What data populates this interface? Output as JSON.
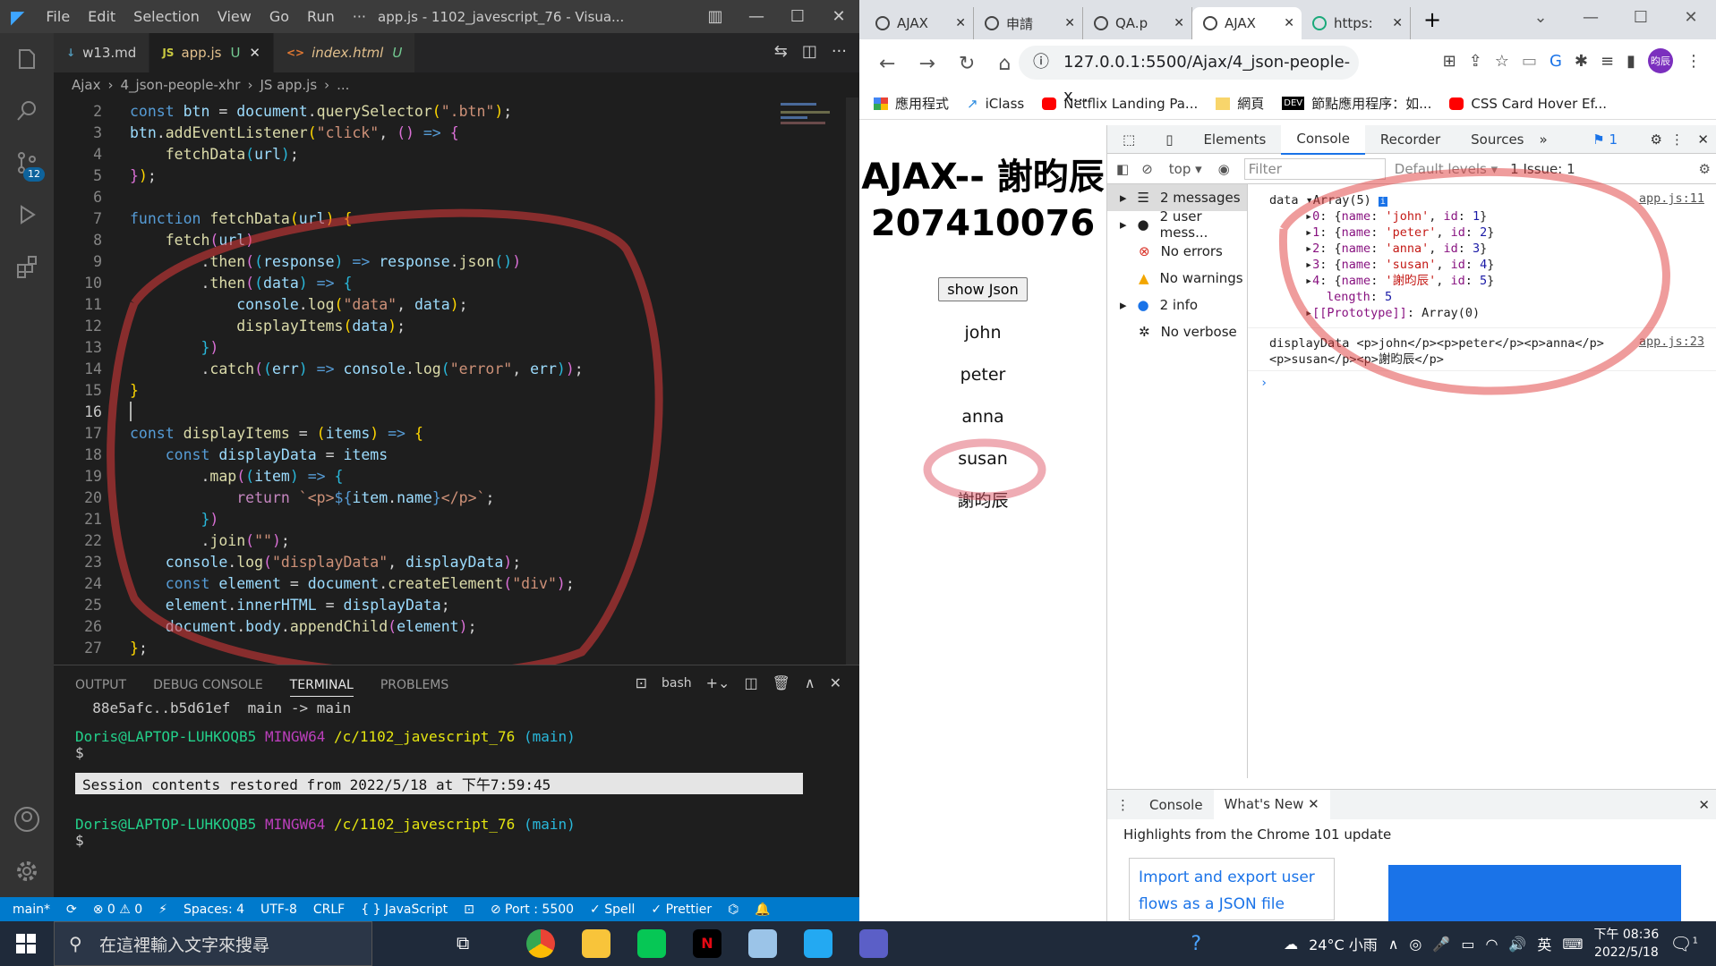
{
  "vscode": {
    "menu": [
      "File",
      "Edit",
      "Selection",
      "View",
      "Go",
      "Run",
      "···"
    ],
    "window_title": "app.js - 1102_javescript_76 - Visua...",
    "scm_badge": "12",
    "tabs": [
      {
        "label": "w13.md",
        "icon": "↓"
      },
      {
        "label": "app.js",
        "icon": "JS",
        "mod": "U"
      },
      {
        "label": "index.html",
        "icon": "<>",
        "mod": "U"
      }
    ],
    "breadcrumb": [
      "Ajax",
      "4_json-people-xhr",
      "JS app.js",
      "..."
    ],
    "code_lines": [
      "2",
      "3",
      "4",
      "5",
      "6",
      "7",
      "8",
      "9",
      "10",
      "11",
      "12",
      "13",
      "14",
      "15",
      "16",
      "17",
      "18",
      "19",
      "20",
      "21",
      "22",
      "23",
      "24",
      "25",
      "26",
      "27"
    ],
    "panel_tabs": [
      "OUTPUT",
      "DEBUG CONSOLE",
      "TERMINAL",
      "PROBLEMS"
    ],
    "shell": "bash",
    "terminal": {
      "l1": "  88e5afc..b5d61ef  main -> main",
      "user": "Doris@LAPTOP-LUHKOQB5",
      "env": "MINGW64",
      "path": "/c/1102_javescript_76",
      "branch": "(main)",
      "prompt": "$",
      "restored": "Session contents restored from 2022/5/18 at 下午7:59:45"
    },
    "status": [
      "main*",
      "⟳",
      "⊗ 0 ⚠ 0",
      "⚡",
      "Spaces: 4",
      "UTF-8",
      "CRLF",
      "{ } JavaScript",
      "⊡",
      "⊘ Port : 5500",
      "✓ Spell",
      "✓ Prettier"
    ]
  },
  "chrome": {
    "tabs": [
      "AJAX",
      "申請",
      "QA.p",
      "AJAX",
      "https:"
    ],
    "url": "127.0.0.1:5500/Ajax/4_json-people-x...",
    "avatar": "昀辰",
    "bookmarks": [
      "應用程式",
      "iClass",
      "Netflix Landing Pa...",
      "網頁",
      "節點應用程序：如...",
      "CSS Card Hover Ef..."
    ],
    "page_title": "AJAX-- 謝昀辰 207410076",
    "button": "show Json",
    "items": [
      "john",
      "peter",
      "anna",
      "susan",
      "謝昀辰"
    ]
  },
  "devtools": {
    "tabs": [
      "Elements",
      "Console",
      "Recorder",
      "Sources"
    ],
    "issues_badge": "1",
    "context": "top",
    "filter_placeholder": "Filter",
    "levels": "Default levels",
    "issue_count": "1 Issue:  1",
    "sidebar": [
      "2 messages",
      "2 user mess...",
      "No errors",
      "No warnings",
      "2 info",
      "No verbose"
    ],
    "log1_link": "app.js:11",
    "log2_link": "app.js:23",
    "drawer_tabs": [
      "Console",
      "What's New"
    ],
    "highlights": "Highlights from the Chrome 101 update",
    "card": "Import and export user flows as a JSON file"
  },
  "taskbar": {
    "search": "在這裡輸入文字來搜尋",
    "weather": "24°C 小雨",
    "ime": "英",
    "time": "下午 08:36",
    "date": "2022/5/18",
    "notif": "1"
  }
}
